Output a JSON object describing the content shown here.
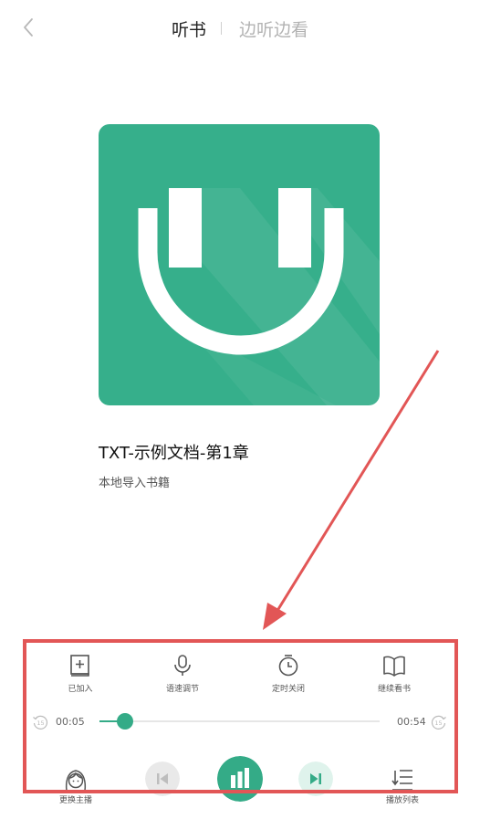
{
  "header": {
    "tab_listen": "听书",
    "tab_listen_read": "边听边看"
  },
  "book": {
    "title": "TXT-示例文档-第1章",
    "subtitle": "本地导入书籍"
  },
  "actions": [
    {
      "label": "已加入",
      "icon": "bookshelf-added-icon"
    },
    {
      "label": "语速调节",
      "icon": "microphone-icon"
    },
    {
      "label": "定时关闭",
      "icon": "timer-icon"
    },
    {
      "label": "继续看书",
      "icon": "open-book-icon"
    }
  ],
  "player": {
    "current_time": "00:05",
    "total_time": "00:54",
    "progress_fraction": 0.09,
    "rewind_seconds": "15",
    "forward_seconds": "15",
    "state": "playing"
  },
  "bottom": {
    "change_anchor_label": "更换主播",
    "playlist_label": "播放列表"
  },
  "colors": {
    "accent": "#34ab87",
    "highlight": "#e25656"
  }
}
